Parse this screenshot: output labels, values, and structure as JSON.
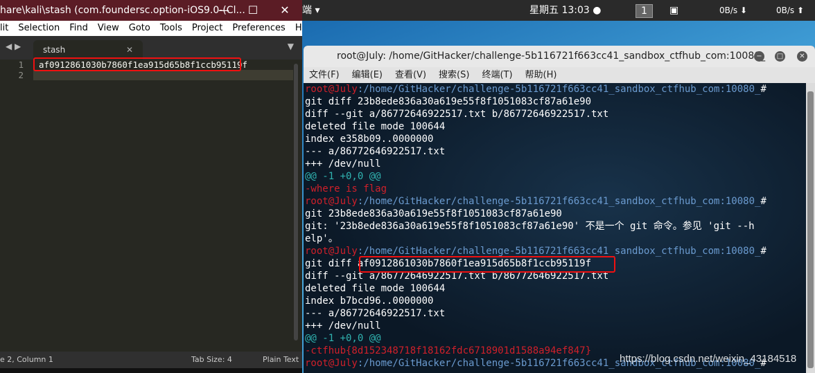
{
  "sublime": {
    "title": "hare\\kali\\stash (com.foundersc.option-iOS9.0-(Cl...",
    "menu": [
      "lit",
      "Selection",
      "Find",
      "View",
      "Goto",
      "Tools",
      "Project",
      "Preferences",
      "Help"
    ],
    "tab": "stash",
    "lines": [
      "af0912861030b7860f1ea915d65b8f1ccb95119f",
      ""
    ],
    "line_numbers": [
      "1",
      "2"
    ],
    "status_left": "e 2, Column 1",
    "tab_size": "Tab Size: 4",
    "syntax": "Plain Text"
  },
  "panel": {
    "menu": "端 ▾",
    "clock": "星期五 13:03 ●",
    "workspace": "1",
    "down": "0B/s ⬇",
    "up": "0B/s ⬆"
  },
  "terminal": {
    "title": "root@July: /home/GitHacker/challenge-5b116721f663cc41_sandbox_ctfhub_com:10080_",
    "menu": [
      "文件(F)",
      "编辑(E)",
      "查看(V)",
      "搜索(S)",
      "终端(T)",
      "帮助(H)"
    ],
    "prompt_user": "root@July",
    "prompt_path": ":/home/GitHacker/challenge-5b116721f663cc41_sandbox_ctfhub_com:10080_",
    "lines": [
      {
        "type": "prompt"
      },
      {
        "type": "out",
        "text": "git diff 23b8ede836a30a619e55f8f1051083cf87a61e90"
      },
      {
        "type": "out",
        "text": "diff --git a/86772646922517.txt b/86772646922517.txt"
      },
      {
        "type": "out",
        "text": "deleted file mode 100644"
      },
      {
        "type": "out",
        "text": "index e358b09..0000000"
      },
      {
        "type": "out",
        "text": "--- a/86772646922517.txt"
      },
      {
        "type": "out",
        "text": "+++ /dev/null"
      },
      {
        "type": "hunk",
        "text": "@@ -1 +0,0 @@"
      },
      {
        "type": "del",
        "text": "-where is flag"
      },
      {
        "type": "prompt"
      },
      {
        "type": "out",
        "text": "git 23b8ede836a30a619e55f8f1051083cf87a61e90"
      },
      {
        "type": "out",
        "text": "git: '23b8ede836a30a619e55f8f1051083cf87a61e90' 不是一个 git 命令。参见 'git --h"
      },
      {
        "type": "out",
        "text": "elp'。"
      },
      {
        "type": "prompt"
      },
      {
        "type": "out",
        "text": "git diff af0912861030b7860f1ea915d65b8f1ccb95119f"
      },
      {
        "type": "out",
        "text": "diff --git a/86772646922517.txt b/86772646922517.txt"
      },
      {
        "type": "out",
        "text": "deleted file mode 100644"
      },
      {
        "type": "out",
        "text": "index b7bcd96..0000000"
      },
      {
        "type": "out",
        "text": "--- a/86772646922517.txt"
      },
      {
        "type": "out",
        "text": "+++ /dev/null"
      },
      {
        "type": "hunk",
        "text": "@@ -1 +0,0 @@"
      },
      {
        "type": "del",
        "text": "-ctfhub{8d152348718f18162fdc6718901d1588a94ef847}"
      },
      {
        "type": "prompt"
      }
    ]
  },
  "watermark": "https://blog.csdn.net/weixin_43184518",
  "colors": {
    "prompt_user": "#d0202a",
    "prompt_path": "#6b9bd0",
    "hunk": "#30b3b0",
    "highlight_box": "#f01010"
  }
}
